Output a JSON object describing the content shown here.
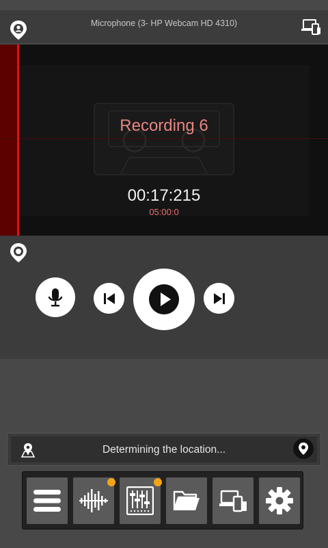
{
  "header": {
    "microphone_label": "Microphone (3- HP Webcam HD 4310)"
  },
  "recording": {
    "title": "Recording 6",
    "elapsed": "00:17:215",
    "limit": "05:00:0"
  },
  "location": {
    "status": "Determining the location..."
  },
  "toolbar": {
    "items": [
      {
        "icon": "menu-icon",
        "badge": false
      },
      {
        "icon": "audio-waveform-icon",
        "badge": true
      },
      {
        "icon": "mixer-icon",
        "badge": true
      },
      {
        "icon": "folder-icon",
        "badge": false
      },
      {
        "icon": "devices-icon",
        "badge": false
      },
      {
        "icon": "gear-icon",
        "badge": false
      }
    ]
  },
  "colors": {
    "accent_red": "#e01010",
    "title_red": "#e88582",
    "badge_orange": "#f4a418"
  }
}
